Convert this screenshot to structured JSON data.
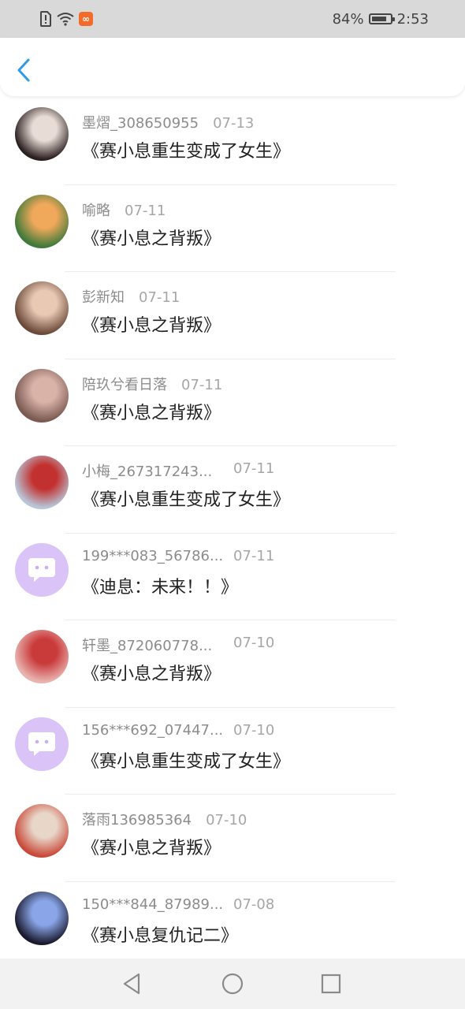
{
  "status_bar": {
    "battery": "84%",
    "time": "2:53",
    "battery_level": 0.84
  },
  "comments": [
    {
      "name": "墨熠_308650955",
      "date": "07-13",
      "title": "《赛小息重生变成了女生》",
      "avatar": "photo",
      "colors": [
        "#2b2020",
        "#e8dcd6"
      ]
    },
    {
      "name": "喻略",
      "date": "07-11",
      "title": "《赛小息之背叛》",
      "avatar": "photo",
      "colors": [
        "#3f7a3a",
        "#f0a85a"
      ]
    },
    {
      "name": "彭新知",
      "date": "07-11",
      "title": "《赛小息之背叛》",
      "avatar": "photo",
      "colors": [
        "#6b4a3a",
        "#e9c9b4"
      ]
    },
    {
      "name": "陪玖兮看日落",
      "date": "07-11",
      "title": "《赛小息之背叛》",
      "avatar": "photo",
      "colors": [
        "#7a5a52",
        "#d9b2a8"
      ]
    },
    {
      "name": "小梅_267317243...",
      "date": "07-11",
      "title": "《赛小息重生变成了女生》",
      "avatar": "photo",
      "colors": [
        "#b8c6d8",
        "#c2312f"
      ]
    },
    {
      "name": "199***083_56786...",
      "date": "07-11",
      "title": "《迪息：未来！！》",
      "avatar": "default",
      "colors": [
        "#d9c3f7",
        "#ffffff"
      ]
    },
    {
      "name": "轩墨_872060778...",
      "date": "07-10",
      "title": "《赛小息之背叛》",
      "avatar": "photo",
      "colors": [
        "#e8b4b0",
        "#c93a3a"
      ]
    },
    {
      "name": "156***692_07447...",
      "date": "07-10",
      "title": "《赛小息重生变成了女生》",
      "avatar": "default",
      "colors": [
        "#d9c3f7",
        "#ffffff"
      ]
    },
    {
      "name": "落雨136985364",
      "date": "07-10",
      "title": "《赛小息之背叛》",
      "avatar": "photo",
      "colors": [
        "#c94a3a",
        "#e8d6c8"
      ]
    },
    {
      "name": "150***844_87989...",
      "date": "07-08",
      "title": "《赛小息复仇记二》",
      "avatar": "photo",
      "colors": [
        "#1a1a2e",
        "#8aa6e8"
      ]
    }
  ]
}
